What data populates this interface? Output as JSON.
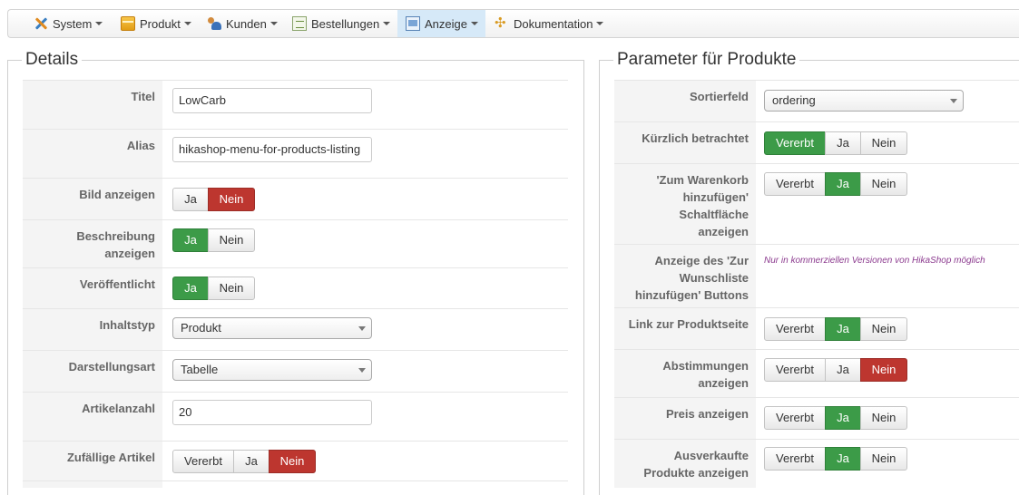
{
  "menu": {
    "items": [
      {
        "label": "System",
        "icon": "tools-icon"
      },
      {
        "label": "Produkt",
        "icon": "product-box-icon"
      },
      {
        "label": "Kunden",
        "icon": "customers-icon"
      },
      {
        "label": "Bestellungen",
        "icon": "orders-icon"
      },
      {
        "label": "Anzeige",
        "icon": "display-icon",
        "active": true
      },
      {
        "label": "Dokumentation",
        "icon": "documentation-icon"
      }
    ]
  },
  "details": {
    "legend": "Details",
    "titel": {
      "label": "Titel",
      "value": "LowCarb"
    },
    "alias": {
      "label": "Alias",
      "value": "hikashop-menu-for-products-listing"
    },
    "bild": {
      "label": "Bild anzeigen",
      "ja": "Ja",
      "nein": "Nein",
      "selected": "Nein"
    },
    "beschreibung": {
      "label": "Beschreibung anzeigen",
      "ja": "Ja",
      "nein": "Nein",
      "selected": "Ja"
    },
    "veroeffentlicht": {
      "label": "Veröffentlicht",
      "ja": "Ja",
      "nein": "Nein",
      "selected": "Ja"
    },
    "inhaltstyp": {
      "label": "Inhaltstyp",
      "value": "Produkt"
    },
    "darstellungsart": {
      "label": "Darstellungsart",
      "value": "Tabelle"
    },
    "artikelanzahl": {
      "label": "Artikelanzahl",
      "value": "20"
    },
    "zufaellig": {
      "label": "Zufällige Artikel",
      "vererbt": "Vererbt",
      "ja": "Ja",
      "nein": "Nein",
      "selected": "Nein"
    }
  },
  "params": {
    "legend": "Parameter für Produkte",
    "sortierfeld": {
      "label": "Sortierfeld",
      "value": "ordering"
    },
    "kuerzlich": {
      "label": "Kürzlich betrachtet",
      "vererbt": "Vererbt",
      "ja": "Ja",
      "nein": "Nein",
      "selected": "Vererbt"
    },
    "warenkorb": {
      "label": "'Zum Warenkorb hinzufügen' Schaltfläche anzeigen",
      "vererbt": "Vererbt",
      "ja": "Ja",
      "nein": "Nein",
      "selected": "Ja"
    },
    "wunschliste": {
      "label": "Anzeige des 'Zur Wunschliste hinzufügen' Buttons",
      "note": "Nur in kommerziellen Versionen von HikaShop möglich"
    },
    "produktseite": {
      "label": "Link zur Produktseite",
      "vererbt": "Vererbt",
      "ja": "Ja",
      "nein": "Nein",
      "selected": "Ja"
    },
    "abstimmungen": {
      "label": "Abstimmungen anzeigen",
      "vererbt": "Vererbt",
      "ja": "Ja",
      "nein": "Nein",
      "selected": "Nein"
    },
    "preis": {
      "label": "Preis anzeigen",
      "vererbt": "Vererbt",
      "ja": "Ja",
      "nein": "Nein",
      "selected": "Ja"
    },
    "ausverkauft": {
      "label": "Ausverkaufte Produkte anzeigen",
      "vererbt": "Vererbt",
      "ja": "Ja",
      "nein": "Nein",
      "selected": "Ja"
    }
  },
  "colors": {
    "selected_yes": "#3c9b48",
    "selected_no": "#bd362f",
    "active_menu": "#d6e9f8",
    "note": "#8c3b8f"
  }
}
